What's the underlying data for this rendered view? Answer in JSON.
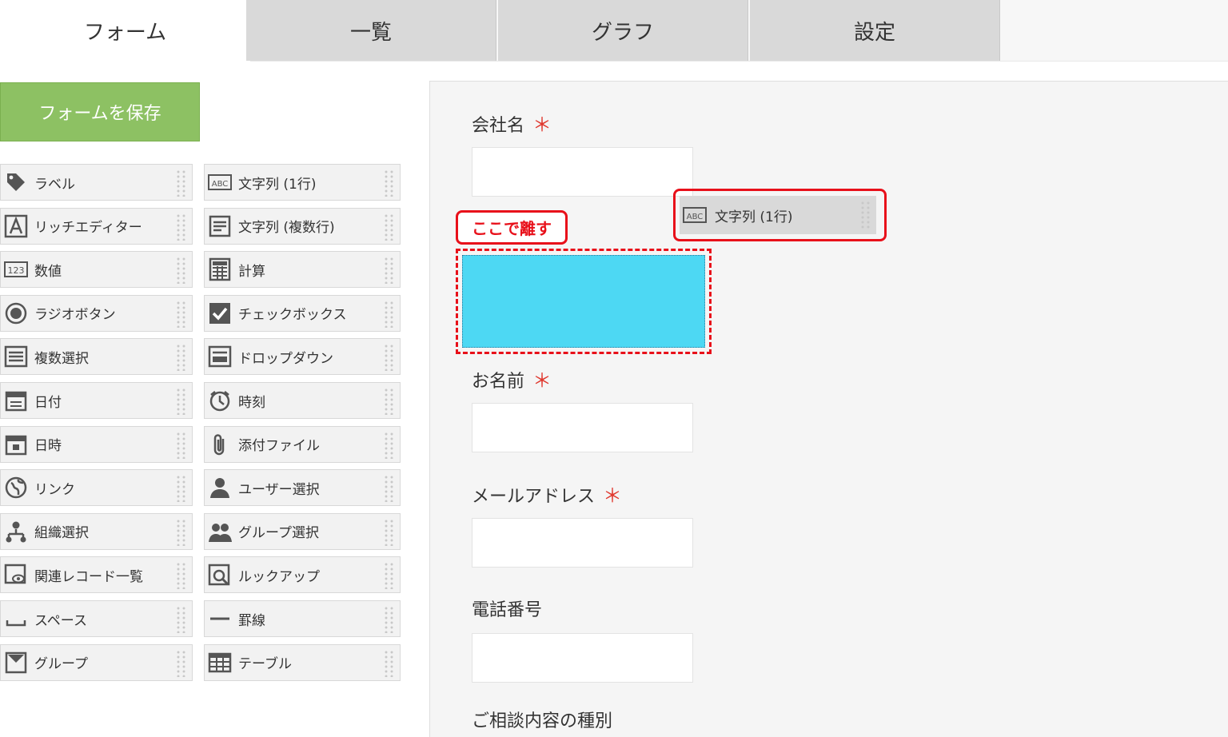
{
  "tabs": [
    {
      "label": "フォーム",
      "active": true
    },
    {
      "label": "一覧"
    },
    {
      "label": "グラフ"
    },
    {
      "label": "設定"
    }
  ],
  "save_button": "フォームを保存",
  "palette": {
    "left": [
      {
        "label": "ラベル",
        "icon": "tag-icon"
      },
      {
        "label": "リッチエディター",
        "icon": "rich-editor-icon"
      },
      {
        "label": "数値",
        "icon": "number-icon"
      },
      {
        "label": "ラジオボタン",
        "icon": "radio-icon"
      },
      {
        "label": "複数選択",
        "icon": "multi-select-icon"
      },
      {
        "label": "日付",
        "icon": "date-icon"
      },
      {
        "label": "日時",
        "icon": "datetime-icon"
      },
      {
        "label": "リンク",
        "icon": "globe-icon"
      },
      {
        "label": "組織選択",
        "icon": "org-icon"
      },
      {
        "label": "関連レコード一覧",
        "icon": "related-records-icon"
      },
      {
        "label": "スペース",
        "icon": "space-icon"
      },
      {
        "label": "グループ",
        "icon": "group-field-icon"
      }
    ],
    "right": [
      {
        "label": "文字列 (1行)",
        "icon": "abc-icon"
      },
      {
        "label": "文字列 (複数行)",
        "icon": "multiline-text-icon"
      },
      {
        "label": "計算",
        "icon": "calculator-icon"
      },
      {
        "label": "チェックボックス",
        "icon": "checkbox-icon"
      },
      {
        "label": "ドロップダウン",
        "icon": "dropdown-icon"
      },
      {
        "label": "時刻",
        "icon": "clock-icon"
      },
      {
        "label": "添付ファイル",
        "icon": "paperclip-icon"
      },
      {
        "label": "ユーザー選択",
        "icon": "user-icon"
      },
      {
        "label": "グループ選択",
        "icon": "users-icon"
      },
      {
        "label": "ルックアップ",
        "icon": "lookup-icon"
      },
      {
        "label": "罫線",
        "icon": "line-icon"
      },
      {
        "label": "テーブル",
        "icon": "table-icon"
      }
    ]
  },
  "form": {
    "fields": [
      {
        "label": "会社名",
        "required": "＊"
      },
      {
        "label": "お名前",
        "required": "＊"
      },
      {
        "label": "メールアドレス",
        "required": "＊"
      },
      {
        "label": "電話番号",
        "required": ""
      }
    ],
    "cut_off_label": "ご相談内容の種別"
  },
  "callout": "ここで離す",
  "dragging_item": {
    "label": "文字列 (1行)",
    "icon": "abc-icon"
  },
  "colors": {
    "save": "#8dc163",
    "drop_highlight": "#4dd8f3",
    "annotation": "#e8101a"
  }
}
